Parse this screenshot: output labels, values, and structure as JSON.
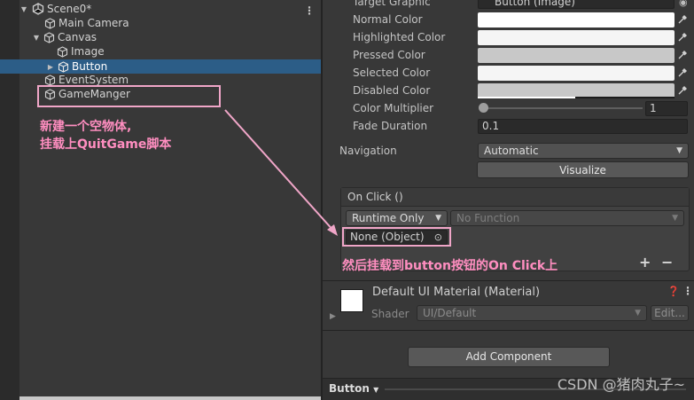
{
  "hierarchy": {
    "scene": "Scene0*",
    "items": [
      {
        "label": "Main Camera"
      },
      {
        "label": "Canvas"
      },
      {
        "label": "Image"
      },
      {
        "label": "Button"
      },
      {
        "label": "EventSystem"
      },
      {
        "label": "GameManger"
      }
    ],
    "annotation_line1": "新建一个空物体,",
    "annotation_line2": "挂载上QuitGame脚本"
  },
  "inspector": {
    "button": {
      "target_graphic_label": "Target Graphic",
      "target_graphic_value": "Button (Image)",
      "normal_color_label": "Normal Color",
      "highlighted_color_label": "Highlighted Color",
      "pressed_color_label": "Pressed Color",
      "selected_color_label": "Selected Color",
      "disabled_color_label": "Disabled Color",
      "color_multiplier_label": "Color Multiplier",
      "color_multiplier_value": "1",
      "fade_duration_label": "Fade Duration",
      "fade_duration_value": "0.1",
      "navigation_label": "Navigation",
      "navigation_value": "Automatic",
      "visualize_label": "Visualize"
    },
    "colors": {
      "normal": "#ffffff",
      "highlighted": "#f5f5f5",
      "pressed": "#c8c8c8",
      "selected": "#f5f5f5",
      "disabled": "#c8c8c8"
    },
    "onclick": {
      "header": "On Click ()",
      "runtime_value": "Runtime Only",
      "function_value": "No Function",
      "object_value": "None (Object)",
      "plus": "+",
      "minus": "−",
      "annotation": "然后挂载到button按钮的On Click上"
    },
    "material": {
      "title": "Default UI Material (Material)",
      "shader_label": "Shader",
      "shader_value": "UI/Default",
      "edit_label": "Edit..."
    },
    "add_component_label": "Add Component",
    "bottom_tab": "Button",
    "watermark": "CSDN @猪肉丸子~"
  },
  "accent": {
    "selection": "#2c5d87",
    "annotation": "#ff8ec0"
  }
}
